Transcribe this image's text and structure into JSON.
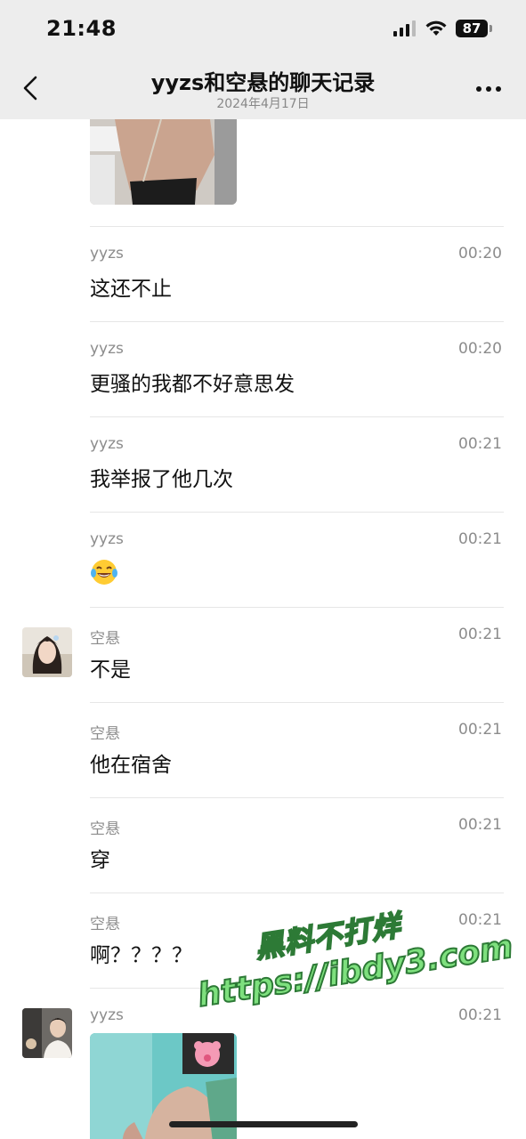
{
  "status_bar": {
    "time": "21:48",
    "battery": "87"
  },
  "header": {
    "title": "yyzs和空悬的聊天记录",
    "subtitle": "2024年4月17日"
  },
  "messages": [
    {
      "sender": "yyzs",
      "time": "00:20",
      "text": "这还不止"
    },
    {
      "sender": "yyzs",
      "time": "00:20",
      "text": "更骚的我都不好意思发"
    },
    {
      "sender": "yyzs",
      "time": "00:21",
      "text": "我举报了他几次"
    },
    {
      "sender": "yyzs",
      "time": "00:21",
      "text": "",
      "emoji": "face-with-tears-of-joy-icon"
    },
    {
      "sender": "空悬",
      "time": "00:21",
      "text": "不是"
    },
    {
      "sender": "空悬",
      "time": "00:21",
      "text": "他在宿舍"
    },
    {
      "sender": "空悬",
      "time": "00:21",
      "text": "穿"
    },
    {
      "sender": "空悬",
      "time": "00:21",
      "text": "啊？？？？"
    },
    {
      "sender": "yyzs",
      "time": "00:21",
      "text": "",
      "image": "photo-message"
    }
  ],
  "watermark": {
    "line1": "黑料不打烊",
    "line2": "https://ibdy3.com"
  }
}
